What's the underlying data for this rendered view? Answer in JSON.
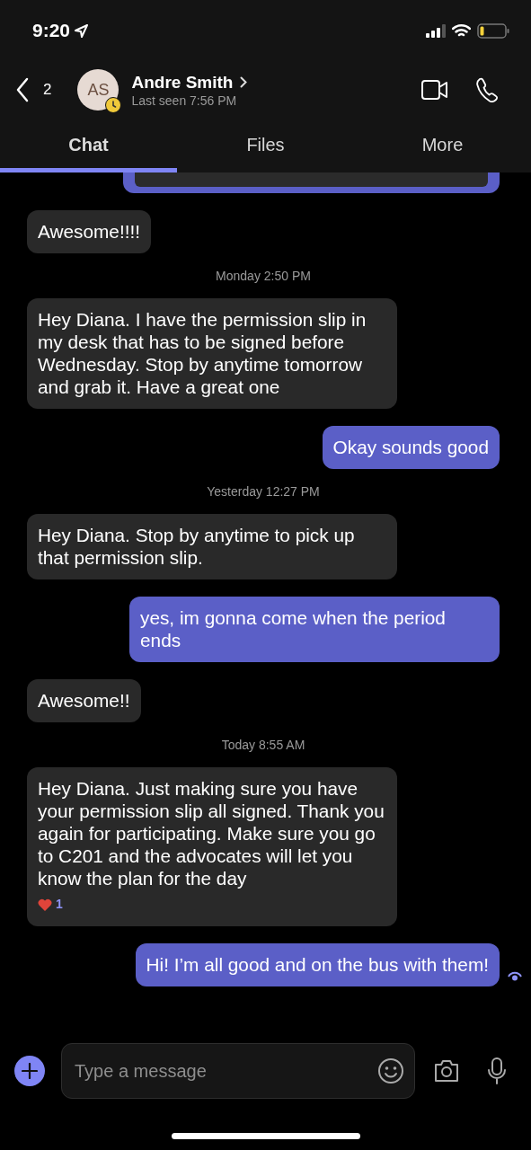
{
  "status_bar": {
    "time": "9:20"
  },
  "header": {
    "back_count": "2",
    "avatar_initials": "AS",
    "name": "Andre Smith",
    "presence": "Last seen 7:56 PM"
  },
  "tabs": [
    {
      "label": "Chat",
      "selected": true
    },
    {
      "label": "Files",
      "selected": false
    },
    {
      "label": "More",
      "selected": false
    }
  ],
  "messages": [
    {
      "kind": "clipped"
    },
    {
      "kind": "incoming",
      "text": "Awesome!!!!"
    },
    {
      "kind": "timestamp",
      "text": "Monday 2:50 PM"
    },
    {
      "kind": "incoming",
      "text": "Hey Diana. I have the permission slip in my desk that has to be signed before Wednesday. Stop by anytime tomorrow and grab it. Have a great one"
    },
    {
      "kind": "outgoing",
      "text": "Okay sounds good"
    },
    {
      "kind": "timestamp",
      "text": "Yesterday 12:27 PM"
    },
    {
      "kind": "incoming",
      "text": "Hey Diana. Stop by anytime to pick up that permission slip."
    },
    {
      "kind": "outgoing",
      "text": "yes, im gonna come when the period ends"
    },
    {
      "kind": "incoming",
      "text": "Awesome!!"
    },
    {
      "kind": "timestamp",
      "text": "Today 8:55 AM"
    },
    {
      "kind": "incoming",
      "text": "Hey Diana.  Just making sure you have your permission slip all signed.  Thank you again for participating.  Make sure you go to C201 and the advocates will let you know the plan for the day",
      "reaction_count": "1"
    },
    {
      "kind": "outgoing",
      "text": "Hi! I’m all good and on the bus with them!",
      "seen": true
    }
  ],
  "composer": {
    "placeholder": "Type a message"
  }
}
